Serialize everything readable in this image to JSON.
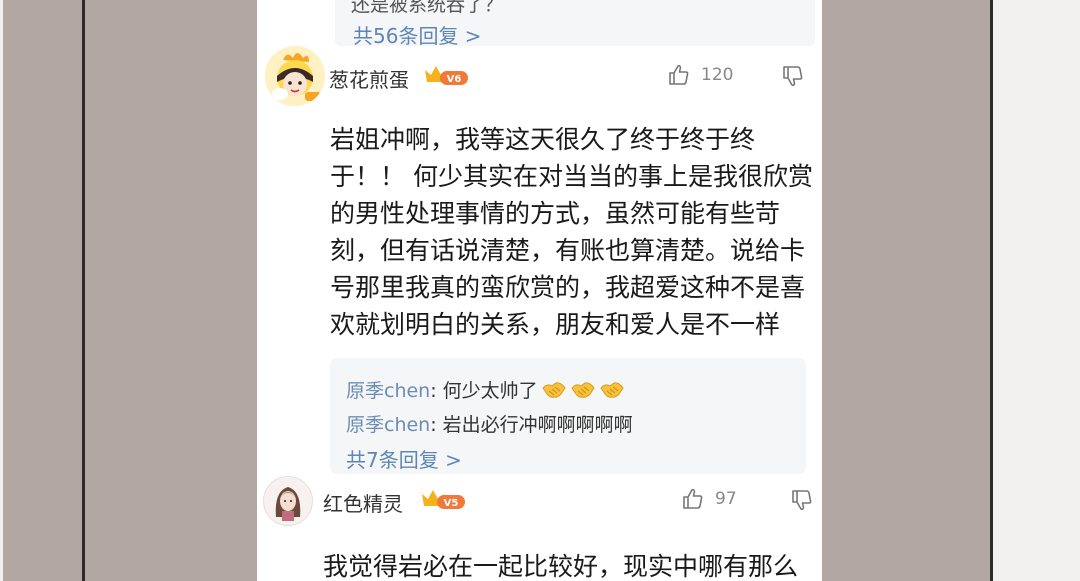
{
  "top_reply": {
    "partial_text": "还是被系统吞了？",
    "more_label": "共56条回复 >"
  },
  "comments": [
    {
      "username": "葱花煎蛋",
      "level": "V6",
      "likes": "120",
      "text_lines": [
        "岩姐冲啊，我等这天很久了终于终于终",
        "于！！ 何少其实在对当当的事上是我很欣赏",
        "的男性处理事情的方式，虽然可能有些苛",
        "刻，但有话说清楚，有账也算清楚。说给卡",
        "号那里我真的蛮欣赏的，我超爱这种不是喜",
        "欢就划明白的关系，朋友和爱人是不一样"
      ],
      "replies": [
        {
          "name": "原季chen",
          "text": ": 何少太帅了",
          "emoji_count": 3
        },
        {
          "name": "原季chen",
          "text": ": 岩出必行冲啊啊啊啊啊"
        }
      ],
      "more_label": "共7条回复 >"
    },
    {
      "username": "红色精灵",
      "level": "V5",
      "likes": "97",
      "text_lines": [
        "我觉得岩必在一起比较好，现实中哪有那么"
      ]
    }
  ],
  "icons": {
    "like": "thumbs-up-icon",
    "dislike": "thumbs-down-icon",
    "badge": "crown-level-badge-icon",
    "emoji": "handshake-emoji-icon"
  },
  "colors": {
    "background": "#b3a7a3",
    "card": "#ffffff",
    "reply_bg": "#f5f6f7",
    "link": "#5f85b6",
    "badge": "#f07a3a"
  }
}
